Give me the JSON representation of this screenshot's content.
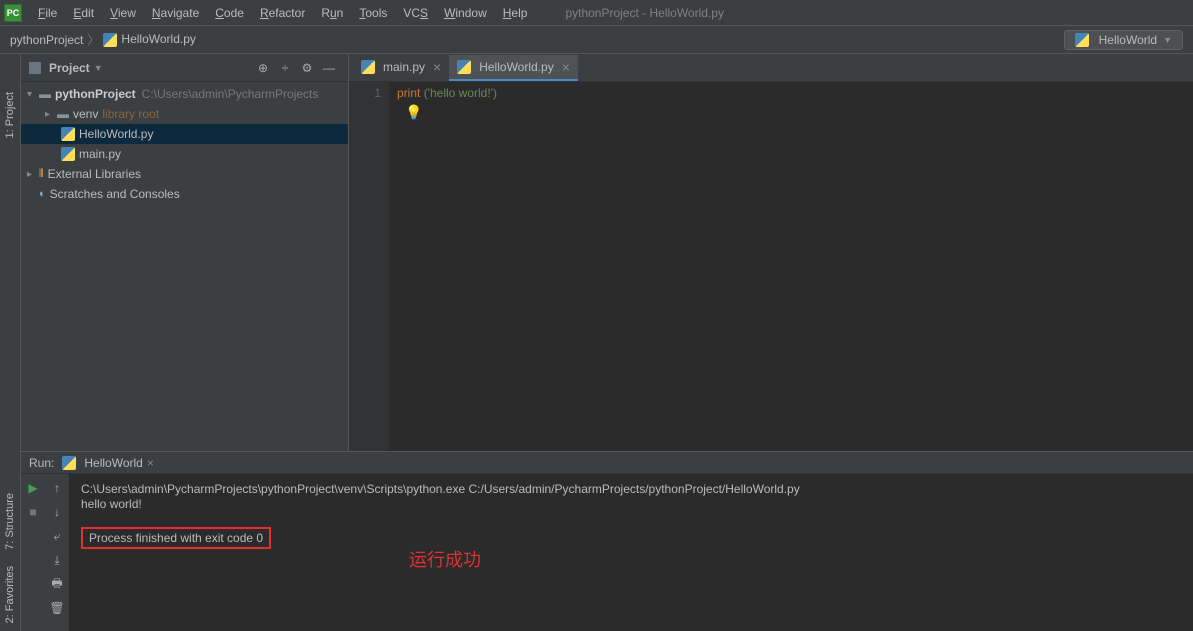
{
  "window_title": "pythonProject - HelloWorld.py",
  "menu": [
    "File",
    "Edit",
    "View",
    "Navigate",
    "Code",
    "Refactor",
    "Run",
    "Tools",
    "VCS",
    "Window",
    "Help"
  ],
  "breadcrumb": {
    "project": "pythonProject",
    "file": "HelloWorld.py"
  },
  "run_config_name": "HelloWorld",
  "project_panel": {
    "title": "Project",
    "root": {
      "name": "pythonProject",
      "path": "C:\\Users\\admin\\PycharmProjects"
    },
    "venv": {
      "name": "venv",
      "tag": "library root"
    },
    "files": [
      "HelloWorld.py",
      "main.py"
    ],
    "ext_lib": "External Libraries",
    "scratches": "Scratches and Consoles"
  },
  "tabs": [
    {
      "name": "main.py",
      "active": false
    },
    {
      "name": "HelloWorld.py",
      "active": true
    }
  ],
  "editor": {
    "line_no": "1",
    "kw": "print",
    "content": "('hello world!')"
  },
  "run": {
    "label": "Run:",
    "tab_name": "HelloWorld",
    "line1": "C:\\Users\\admin\\PycharmProjects\\pythonProject\\venv\\Scripts\\python.exe C:/Users/admin/PycharmProjects/pythonProject/HelloWorld.py",
    "line2": "hello world!",
    "line3": "Process finished with exit code 0"
  },
  "annotation": "运行成功",
  "left_tabs": {
    "project": "1: Project",
    "structure": "7: Structure",
    "favorites": "2: Favorites"
  }
}
